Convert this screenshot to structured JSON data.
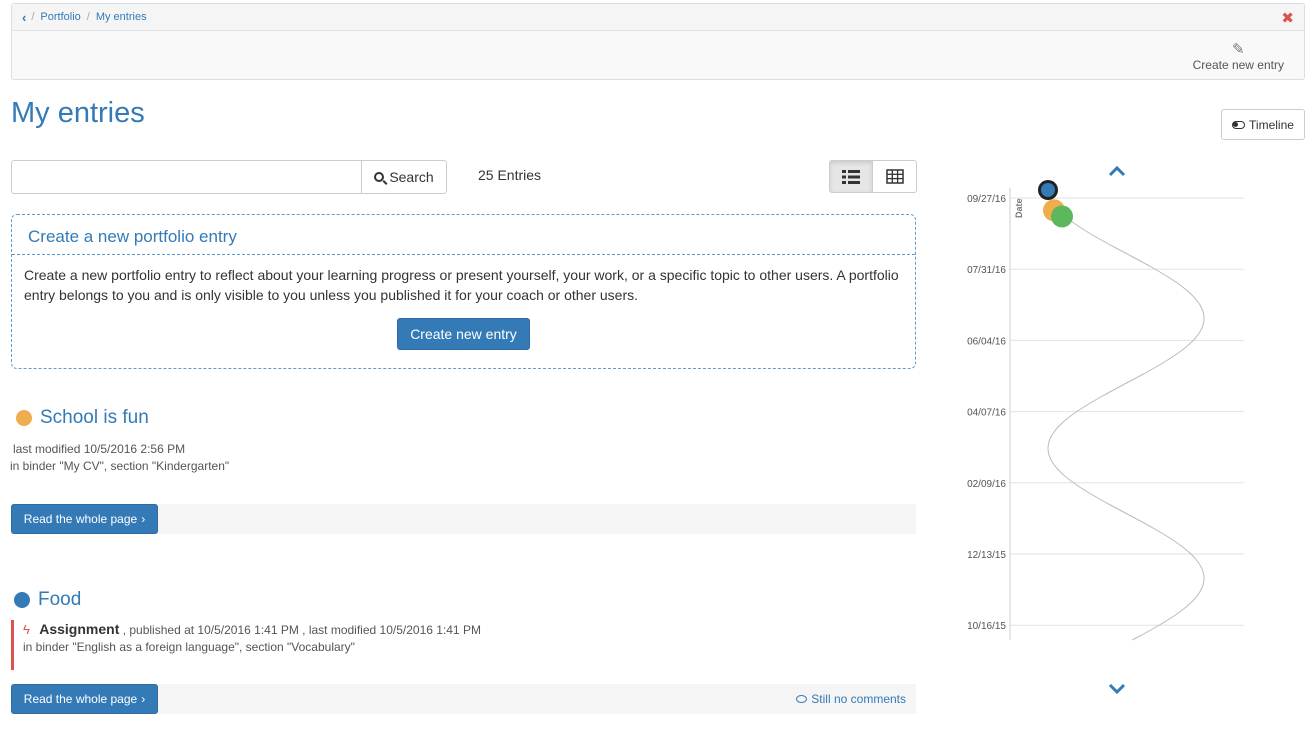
{
  "breadcrumb": {
    "back_label": "<",
    "items": [
      "Portfolio",
      "My entries"
    ],
    "separator": "/"
  },
  "toolbar": {
    "create_label": "Create new entry"
  },
  "page": {
    "title": "My entries",
    "timeline_label": "Timeline"
  },
  "search": {
    "value": "",
    "button_label": "Search",
    "count_label": "25 Entries"
  },
  "create_box": {
    "heading": "Create a new portfolio entry",
    "text": "Create a new portfolio entry to reflect about your learning progress or present yourself, your work, or a specific topic to other users. A portfolio entry belongs to you and is only visible to you unless you published it for your coach or other users.",
    "button_label": "Create new entry"
  },
  "entries": [
    {
      "title": "School is fun",
      "dot_color": "#f0ad4e",
      "modified": "last modified 10/5/2016 2:56 PM",
      "binder": "in binder \"My CV\", section \"Kindergarten\"",
      "read_label": "Read the whole page"
    },
    {
      "title": "Food",
      "dot_color": "#337ab7",
      "assignment_label": "Assignment",
      "assignment_meta": ", published at 10/5/2016 1:41 PM , last modified 10/5/2016 1:41 PM",
      "binder": "in binder \"English as a foreign language\", section \"Vocabulary\"",
      "read_label": "Read the whole page",
      "comments_label": "Still no comments"
    }
  ],
  "timeline": {
    "y_label": "Date",
    "ticks": [
      "09/27/16",
      "07/31/16",
      "06/04/16",
      "04/07/16",
      "02/09/16",
      "12/13/15",
      "10/16/15"
    ],
    "points": [
      {
        "date": "09/27/16",
        "color": "#337ab7"
      },
      {
        "date": "09/17/16",
        "color": "#f0ad4e"
      },
      {
        "date": "09/12/16",
        "color": "#5cb85c"
      }
    ],
    "icons": {
      "up": "chevron-up-icon",
      "down": "chevron-down-icon"
    }
  }
}
